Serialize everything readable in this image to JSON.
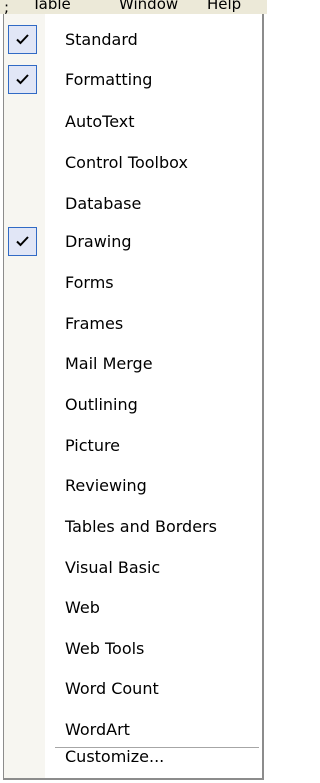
{
  "menubar": {
    "table_label": "Table",
    "window_label": "Window",
    "help_label": "Help"
  },
  "menu": {
    "items": [
      {
        "label": "Standard",
        "checked": true
      },
      {
        "label": "Formatting",
        "checked": true
      },
      {
        "label": "AutoText",
        "checked": false
      },
      {
        "label": "Control Toolbox",
        "checked": false
      },
      {
        "label": "Database",
        "checked": false
      },
      {
        "label": "Drawing",
        "checked": true
      },
      {
        "label": "Forms",
        "checked": false
      },
      {
        "label": "Frames",
        "checked": false
      },
      {
        "label": "Mail Merge",
        "checked": false
      },
      {
        "label": "Outlining",
        "checked": false
      },
      {
        "label": "Picture",
        "checked": false
      },
      {
        "label": "Reviewing",
        "checked": false
      },
      {
        "label": "Tables and Borders",
        "checked": false
      },
      {
        "label": "Visual Basic",
        "checked": false
      },
      {
        "label": "Web",
        "checked": false
      },
      {
        "label": "Web Tools",
        "checked": false
      },
      {
        "label": "Word Count",
        "checked": false
      },
      {
        "label": "WordArt",
        "checked": false
      }
    ],
    "customize_label": "Customize..."
  },
  "colors": {
    "check_bg": "#e1e6f6",
    "check_border": "#316ac5",
    "menu_border": "#8c8c8c"
  }
}
